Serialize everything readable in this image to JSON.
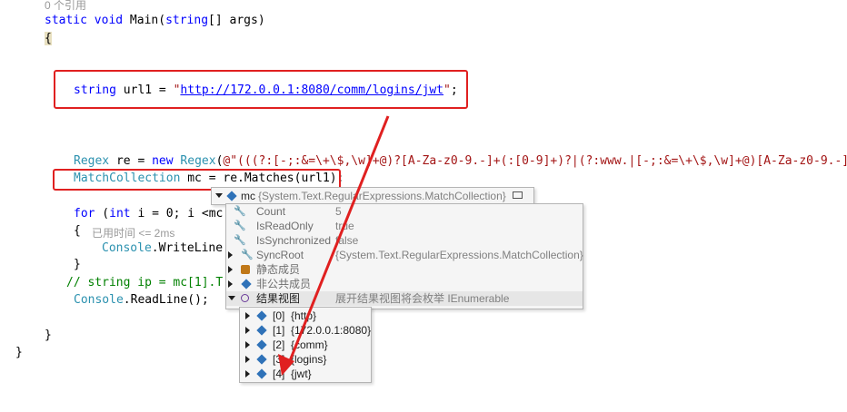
{
  "editor": {
    "codelens": "0 个引用",
    "line_main": {
      "kw": "static void",
      "rest": " Main(",
      "kw2": "string",
      "rest2": "[] args)"
    },
    "open_brace": "{",
    "line_url": {
      "kw": "string",
      "rest": " url1 = ",
      "q1": "\"",
      "link": "http://172.0.0.1:8080/comm/logins/jwt",
      "q2": "\"",
      "end": ";"
    },
    "line_regex": {
      "ty": "Regex",
      "rest1": " re = ",
      "kw": "new",
      "rest2": " ",
      "ty2": "Regex",
      "rest3": "(",
      "str": "@\"(((?:[-;:&=\\+\\$,\\w]+@)?[A-Za-z0-9.-]+(:[0-9]+)?|(?:www.|[-;:&=\\+\\$,\\w]+@)[A-Za-z0-9.-]"
    },
    "line_mc": {
      "ty": "MatchCollection",
      "rest": " mc = re.Matches(url1);"
    },
    "line_for": {
      "kw": "for",
      "rest1": " (",
      "kw2": "int",
      "rest2": " i = 0; i <mc"
    },
    "line_brace2": "{",
    "elapsed": "已用时间 <= 2ms",
    "line_console": {
      "ty": "Console",
      "rest": ".WriteLine"
    },
    "line_close1": "}",
    "line_comment": "// string ip = mc[1].T",
    "line_readline": {
      "ty": "Console",
      "rest": ".ReadLine();"
    },
    "line_close2": "}",
    "line_close3": "}"
  },
  "datatip": {
    "header_name": "mc",
    "header_value": "{System.Text.RegularExpressions.MatchCollection}",
    "rows": [
      {
        "name": "Count",
        "value": "5",
        "icon": "wrench-icon"
      },
      {
        "name": "IsReadOnly",
        "value": "true",
        "icon": "wrench-icon"
      },
      {
        "name": "IsSynchronized",
        "value": "false",
        "icon": "wrench-icon"
      },
      {
        "name": "SyncRoot",
        "value": "{System.Text.RegularExpressions.MatchCollection}",
        "icon": "wrench-icon"
      },
      {
        "name": "静态成员",
        "value": "",
        "icon": "static-members-icon"
      },
      {
        "name": "非公共成员",
        "value": "",
        "icon": "nonpublic-members-icon"
      },
      {
        "name": "结果视图",
        "value": "展开结果视图将会枚举 IEnumerable",
        "icon": "results-view-icon"
      }
    ]
  },
  "results": {
    "items": [
      {
        "index": "[0]",
        "value": "{http}"
      },
      {
        "index": "[1]",
        "value": "{172.0.0.1:8080}"
      },
      {
        "index": "[2]",
        "value": "{comm}"
      },
      {
        "index": "[3]",
        "value": "{logins}"
      },
      {
        "index": "[4]",
        "value": "{jwt}"
      }
    ]
  },
  "colors": {
    "annotation": "#e02020",
    "keyword": "#0000ff",
    "type": "#2b91af",
    "string": "#a31515",
    "comment": "#008000"
  }
}
